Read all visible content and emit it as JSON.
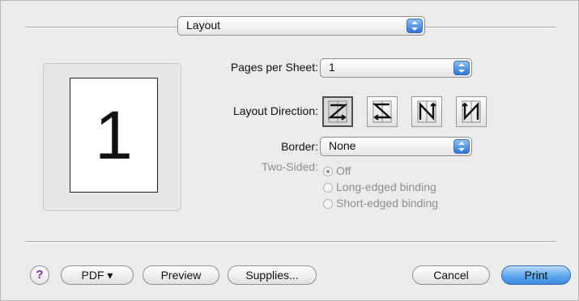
{
  "header": {
    "panel_popup_value": "Layout"
  },
  "preview": {
    "page_number": "1"
  },
  "pages_per_sheet": {
    "label": "Pages per Sheet:",
    "value": "1"
  },
  "layout_direction": {
    "label": "Layout Direction:",
    "options": [
      {
        "name": "Z",
        "selected": true
      },
      {
        "name": "S",
        "selected": false
      },
      {
        "name": "N-reverse",
        "selected": false
      },
      {
        "name": "N",
        "selected": false
      }
    ]
  },
  "border": {
    "label": "Border:",
    "value": "None"
  },
  "two_sided": {
    "label": "Two-Sided:",
    "options": [
      "Off",
      "Long-edged binding",
      "Short-edged binding"
    ],
    "selected": "Off"
  },
  "footer": {
    "help_label": "?",
    "pdf_label": "PDF ▾",
    "preview_label": "Preview",
    "supplies_label": "Supplies...",
    "cancel_label": "Cancel",
    "print_label": "Print"
  },
  "colors": {
    "accent": "#3c8be0",
    "disabled_text": "#8f8f8f"
  }
}
